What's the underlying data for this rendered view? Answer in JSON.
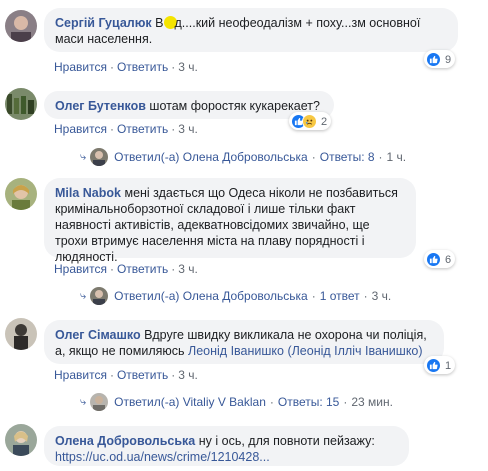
{
  "actions": {
    "like": "Нравится",
    "reply": "Ответить",
    "separator": "·"
  },
  "comments": [
    {
      "author": "Сергій Гуцалюк",
      "text_a": "В",
      "text_b": "д....кий неофеодалізм + поху...зм основної маси населення.",
      "time": "3 ч.",
      "reactions": {
        "count": "9",
        "types": [
          "like-icon"
        ]
      }
    },
    {
      "author": "Олег Бутенков",
      "text": "шотам форостяк кукарекает?",
      "time": "3 ч.",
      "reactions": {
        "count": "2",
        "types": [
          "like-icon",
          "sad-icon"
        ]
      },
      "replies": {
        "label": "Ответил(-а) Олена Добровольська",
        "count_text": "Ответы: 8",
        "time": "1 ч."
      }
    },
    {
      "author": "Mila Nabok",
      "text": "мені здається що Одеса ніколи не позбавиться кримінальноборзотної складової і лише тільки факт наявності активістів, адекватновсідомих звичайно, ще трохи втримує населення міста на плаву порядності і людяності.",
      "time": "3 ч.",
      "reactions": {
        "count": "6",
        "types": [
          "like-icon"
        ]
      },
      "replies": {
        "label": "Ответил(-а) Олена Добровольська",
        "count_text": "1 ответ",
        "time": "3 ч."
      }
    },
    {
      "author": "Олег Сімашко",
      "text_a": "Вдруге швидку викликала не охорона чи поліція, а, якщо не помиляюсь",
      "mention": "Леонід Іванишко (Леонід Ілліч Іванишко)",
      "time": "3 ч.",
      "reactions": {
        "count": "1",
        "types": [
          "like-icon"
        ]
      },
      "replies": {
        "label": "Ответил(-а) Vitaliy V Baklan",
        "count_text": "Ответы: 15",
        "time": "23 мин."
      }
    },
    {
      "author": "Олена Добровольська",
      "text": "ну і ось, для повноти пейзажу:",
      "link": "https://uc.od.ua/news/crime/1210428..."
    }
  ],
  "colors": {
    "link": "#385898",
    "bubble": "#f2f3f5",
    "meta": "#606770",
    "like": "#1877f2",
    "highlight": "#f5e400"
  }
}
